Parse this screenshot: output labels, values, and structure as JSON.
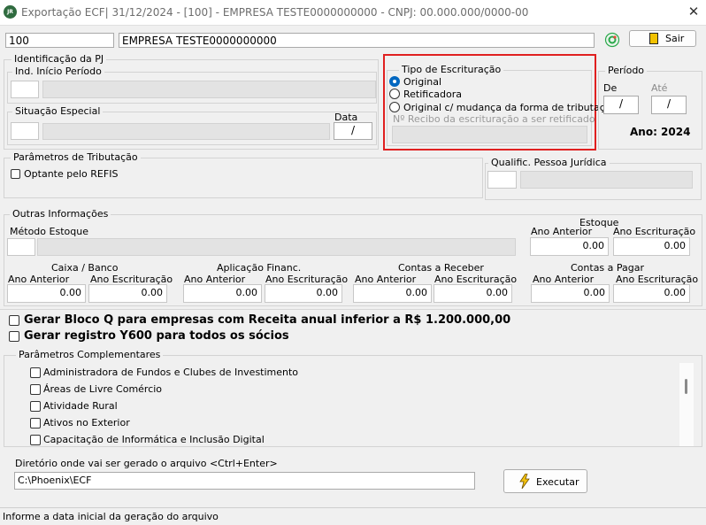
{
  "window": {
    "title": "Exportação ECF| 31/12/2024 - [100] - EMPRESA TESTE0000000000 - CNPJ: 00.000.000/0000-00",
    "app_icon_text": "JR",
    "close_glyph": "✕"
  },
  "header": {
    "company_code": "100",
    "company_name": "EMPRESA TESTE0000000000",
    "exit_label": "Sair"
  },
  "identificacao": {
    "legend": "Identificação da PJ",
    "inicio_periodo": "Ind. Início Período",
    "situacao_especial": "Situação Especial",
    "data_label": "Data",
    "data_value": "/"
  },
  "escrituracao": {
    "legend": "Tipo de Escrituração",
    "options": [
      "Original",
      "Retificadora",
      "Original c/ mudança da forma de tributação"
    ],
    "selected_index": 0,
    "recibo_placeholder": "Nº Recibo da escrituração a ser retificado"
  },
  "periodo": {
    "legend": "Período",
    "de_label": "De",
    "ate_label": "Até",
    "de_value": "/",
    "ate_value": "/",
    "ano_text": "Ano: 2024"
  },
  "tributacao": {
    "legend": "Parâmetros de Tributação",
    "refis_label": "Optante pelo REFIS",
    "qualific_label": "Qualific. Pessoa Jurídica"
  },
  "outras": {
    "legend": "Outras Informações",
    "metodo_estoque": "Método Estoque",
    "estoque_title": "Estoque",
    "ano_anterior": "Ano Anterior",
    "ano_anterior_spaced": "Ano  Anterior",
    "ano_escrituracao": "Ano Escrituração",
    "groups": [
      {
        "title": "Caixa / Banco",
        "anterior": "0.00",
        "escrituracao": "0.00"
      },
      {
        "title": "Aplicação Financ.",
        "anterior": "0.00",
        "escrituracao": "0.00"
      },
      {
        "title": "Contas a Receber",
        "anterior": "0.00",
        "escrituracao": "0.00"
      },
      {
        "title": "Contas a Pagar",
        "anterior": "0.00",
        "escrituracao": "0.00"
      }
    ],
    "estoque_anterior": "0.00",
    "estoque_escrituracao": "0.00"
  },
  "bloco_q_label": "Gerar Bloco Q para empresas com Receita anual inferior a R$ 1.200.000,00",
  "y600_label": "Gerar registro Y600 para todos os sócios",
  "complementares": {
    "legend": "Parâmetros Complementares",
    "items": [
      "Administradora de Fundos e Clubes de Investimento",
      "Áreas de Livre Comércio",
      "Atividade Rural",
      "Ativos no Exterior",
      "Capacitação de Informática e Inclusão Digital"
    ]
  },
  "diretorio": {
    "label": "Diretório onde vai ser gerado o arquivo <Ctrl+Enter>",
    "value": "C:\\Phoenix\\ECF",
    "executar_label": "Executar"
  },
  "status_text": "Informe a data inicial da geração do arquivo",
  "colors": {
    "highlight": "#e02020",
    "radio_accent": "#0067c0",
    "ok_icon": "#2aa84a"
  }
}
